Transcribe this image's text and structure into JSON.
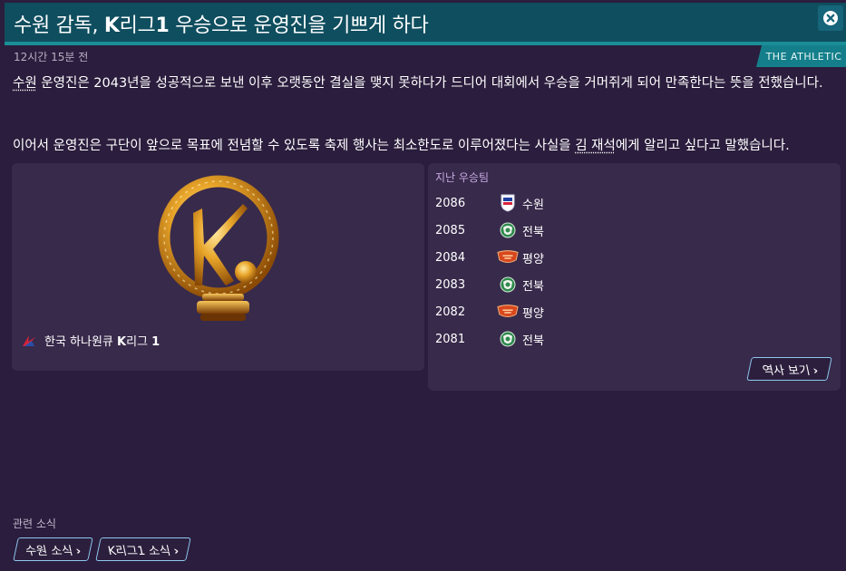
{
  "header": {
    "title_part1": "수원 감독, ",
    "title_bold": "K",
    "title_part2": "리그",
    "title_bold2": "1",
    "title_part3": " 우승으로 운영진을 기쁘게 하다",
    "close_icon": "close-icon"
  },
  "meta": {
    "time": "12시간 15분 전",
    "source": "THE ATHLETIC"
  },
  "article": {
    "para1_a": "수원",
    "para1_b": " 운영진은 2043년을 성공적으로 보낸 이후 오랫동안 결실을 맺지 못하다가 드디어 대회에서 우승을 거머쥐게 되어 만족한다는 뜻을 전했습니다.",
    "para2_a": "이어서 운영진은 구단이 앞으로 목표에 전념할 수 있도록 축제 행사는 최소한도로 이루어졌다는 사실을 ",
    "para2_b": "김 재석",
    "para2_c": "에게 알리고 싶다고 말했습니다."
  },
  "trophy": {
    "league_name_a": "한국 하나원큐 ",
    "league_name_b": "K",
    "league_name_c": "리그 ",
    "league_name_d": "1"
  },
  "history": {
    "title": "지난 우승팀",
    "rows": [
      {
        "year": "2086",
        "team": "수원",
        "badge": "suwon"
      },
      {
        "year": "2085",
        "team": "전북",
        "badge": "jeonbuk"
      },
      {
        "year": "2084",
        "team": "평양",
        "badge": "pyongyang"
      },
      {
        "year": "2083",
        "team": "전북",
        "badge": "jeonbuk"
      },
      {
        "year": "2082",
        "team": "평양",
        "badge": "pyongyang"
      },
      {
        "year": "2081",
        "team": "전북",
        "badge": "jeonbuk"
      }
    ],
    "view_button": "역사 보기"
  },
  "related": {
    "label": "관련 소식",
    "links": [
      "수원 소식",
      "K리그1 소식"
    ]
  },
  "colors": {
    "background": "#2b1d3d",
    "header": "#0f4e5f",
    "accent": "#1a8d97",
    "panel": "#382a4b",
    "link_border": "#8fc7ef"
  }
}
